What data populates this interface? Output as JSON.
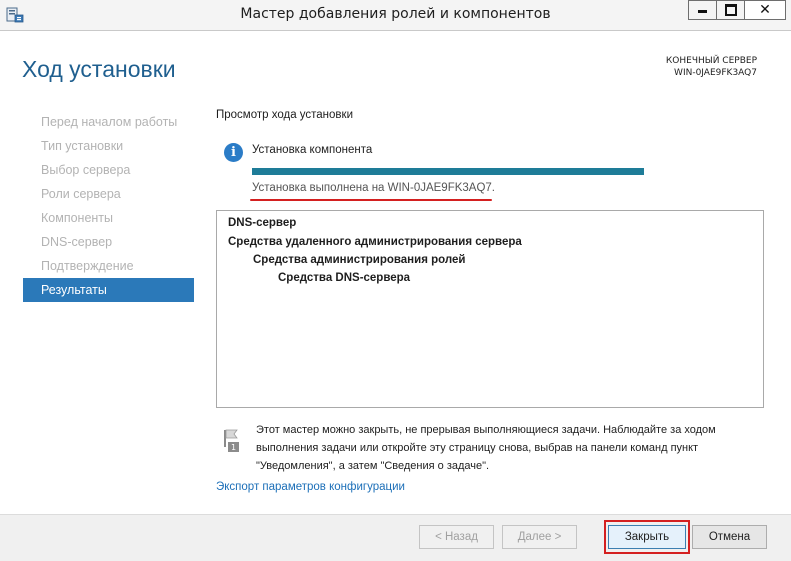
{
  "window": {
    "title": "Мастер добавления ролей и компонентов",
    "close_glyph": "✕"
  },
  "header": {
    "title": "Ход установки",
    "destination_label": "КОНЕЧНЫЙ СЕРВЕР",
    "destination_server": "WIN-0JAE9FK3AQ7"
  },
  "nav": {
    "items": [
      {
        "label": "Перед началом работы"
      },
      {
        "label": "Тип установки"
      },
      {
        "label": "Выбор сервера"
      },
      {
        "label": "Роли сервера"
      },
      {
        "label": "Компоненты"
      },
      {
        "label": "DNS-сервер"
      },
      {
        "label": "Подтверждение"
      },
      {
        "label": "Результаты"
      }
    ],
    "active_index": 7
  },
  "content": {
    "section_title": "Просмотр хода установки",
    "status_text": "Установка компонента",
    "progress_percent": 100,
    "result_text": "Установка выполнена на WIN-0JAE9FK3AQ7.",
    "results": [
      "DNS-сервер",
      "Средства удаленного администрирования сервера",
      "Средства администрирования ролей",
      "Средства DNS-сервера"
    ],
    "note": "Этот мастер можно закрыть, не прерывая выполняющиеся задачи. Наблюдайте за ходом выполнения задачи или откройте эту страницу снова, выбрав на панели команд пункт \"Уведомления\", а затем \"Сведения о задаче\".",
    "export_link": "Экспорт параметров конфигурации"
  },
  "footer": {
    "back": "< Назад",
    "next": "Далее >",
    "close": "Закрыть",
    "cancel": "Отмена"
  },
  "colors": {
    "accent": "#2b79b9",
    "title_blue": "#1f5f8f",
    "progress": "#1e7c98",
    "highlight_red": "#d42020",
    "link": "#1c6fb8"
  },
  "icons": {
    "app": "server-manager-icon",
    "info": "info-icon",
    "note": "flag-notification-icon"
  }
}
